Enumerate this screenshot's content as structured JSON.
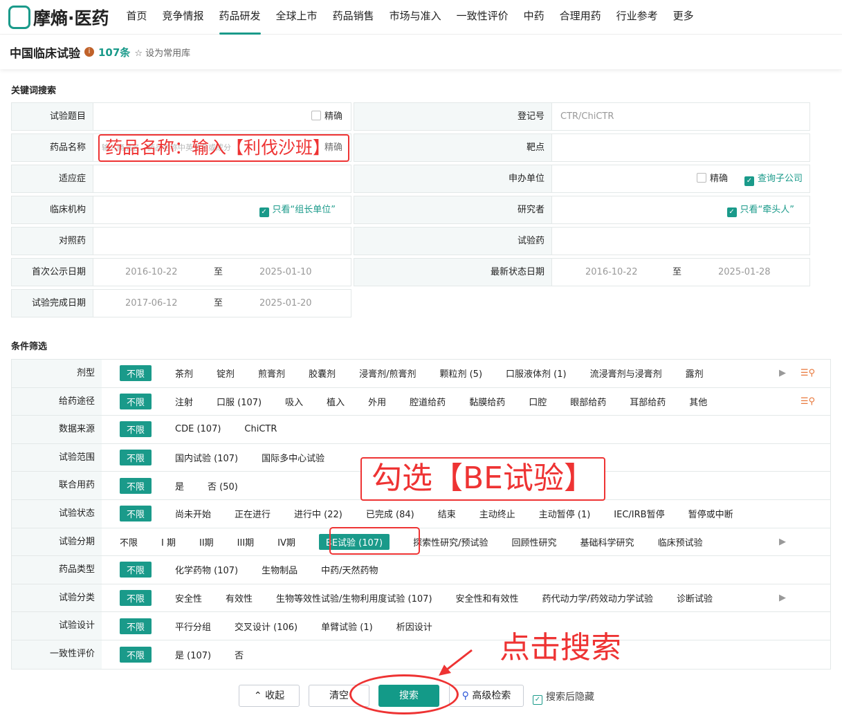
{
  "brand": "摩熵·医药",
  "nav": [
    "首页",
    "竞争情报",
    "药品研发",
    "全球上市",
    "药品销售",
    "市场与准入",
    "一致性评价",
    "中药",
    "合理用药",
    "行业参考",
    "更多"
  ],
  "page": {
    "title": "中国临床试验",
    "count": "107条",
    "favorite": "设为常用库"
  },
  "keyword_section": "关键词搜索",
  "fields": {
    "trial_title": {
      "label": "试验题目",
      "exact": "精确"
    },
    "reg_no": {
      "label": "登记号",
      "placeholder": "CTR/ChiCTR"
    },
    "drug_name": {
      "label": "药品名称",
      "placeholder": "输入商品名、药品名称中英文名或成分",
      "exact": "精确"
    },
    "target": {
      "label": "靶点"
    },
    "indication": {
      "label": "适应症"
    },
    "sponsor": {
      "label": "申办单位",
      "exact": "精确",
      "subsidiary": "查询子公司"
    },
    "institution": {
      "label": "临床机构",
      "only": "只看“组长单位”"
    },
    "investigator": {
      "label": "研究者",
      "only": "只看“牵头人”"
    },
    "control_drug": {
      "label": "对照药"
    },
    "test_drug": {
      "label": "试验药"
    },
    "first_date": {
      "label": "首次公示日期",
      "from": "2016-10-22",
      "to_label": "至",
      "to": "2025-01-10"
    },
    "latest_date": {
      "label": "最新状态日期",
      "from": "2016-10-22",
      "to_label": "至",
      "to": "2025-01-28"
    },
    "complete_date": {
      "label": "试验完成日期",
      "from": "2017-06-12",
      "to_label": "至",
      "to": "2025-01-20"
    }
  },
  "filter_section": "条件筛选",
  "filters": [
    {
      "label": "剂型",
      "options": [
        "不限",
        "茶剂",
        "锭剂",
        "煎膏剂",
        "胶囊剂",
        "浸膏剂/煎膏剂",
        "颗粒剂 (5)",
        "口服液体剂 (1)",
        "流浸膏剂与浸膏剂",
        "露剂"
      ]
    },
    {
      "label": "给药途径",
      "options": [
        "不限",
        "注射",
        "口服 (107)",
        "吸入",
        "植入",
        "外用",
        "腔道给药",
        "黏膜给药",
        "口腔",
        "眼部给药",
        "耳部给药",
        "其他"
      ]
    },
    {
      "label": "数据来源",
      "options": [
        "不限",
        "CDE (107)",
        "ChiCTR"
      ]
    },
    {
      "label": "试验范围",
      "options": [
        "不限",
        "国内试验 (107)",
        "国际多中心试验"
      ]
    },
    {
      "label": "联合用药",
      "options": [
        "不限",
        "是",
        "否 (50)"
      ]
    },
    {
      "label": "试验状态",
      "options": [
        "不限",
        "尚未开始",
        "正在进行",
        "进行中 (22)",
        "已完成 (84)",
        "结束",
        "主动终止",
        "主动暂停 (1)",
        "IEC/IRB暂停",
        "暂停或中断"
      ]
    },
    {
      "label": "试验分期",
      "options": [
        "不限",
        "I 期",
        "II期",
        "III期",
        "IV期",
        "BE试验 (107)",
        "探索性研究/预试验",
        "回顾性研究",
        "基础科学研究",
        "临床预试验"
      ]
    },
    {
      "label": "药品类型",
      "options": [
        "不限",
        "化学药物 (107)",
        "生物制品",
        "中药/天然药物"
      ]
    },
    {
      "label": "试验分类",
      "options": [
        "不限",
        "安全性",
        "有效性",
        "生物等效性试验/生物利用度试验 (107)",
        "安全性和有效性",
        "药代动力学/药效动力学试验",
        "诊断试验"
      ]
    },
    {
      "label": "试验设计",
      "options": [
        "不限",
        "平行分组",
        "交叉设计 (106)",
        "单臂试验 (1)",
        "析因设计"
      ]
    },
    {
      "label": "一致性评价",
      "options": [
        "不限",
        "是 (107)",
        "否"
      ]
    }
  ],
  "buttons": {
    "collapse": "收起",
    "clear": "清空",
    "search": "搜索",
    "advanced": "高级检索",
    "hide_after": "搜索后隐藏"
  },
  "annotations": {
    "drug": "药品名称：输入【利伐沙班】",
    "be": "勾选【BE试验】",
    "click": "点击搜索"
  },
  "colors": {
    "accent": "#1a9a8a",
    "annotation": "#e33"
  }
}
